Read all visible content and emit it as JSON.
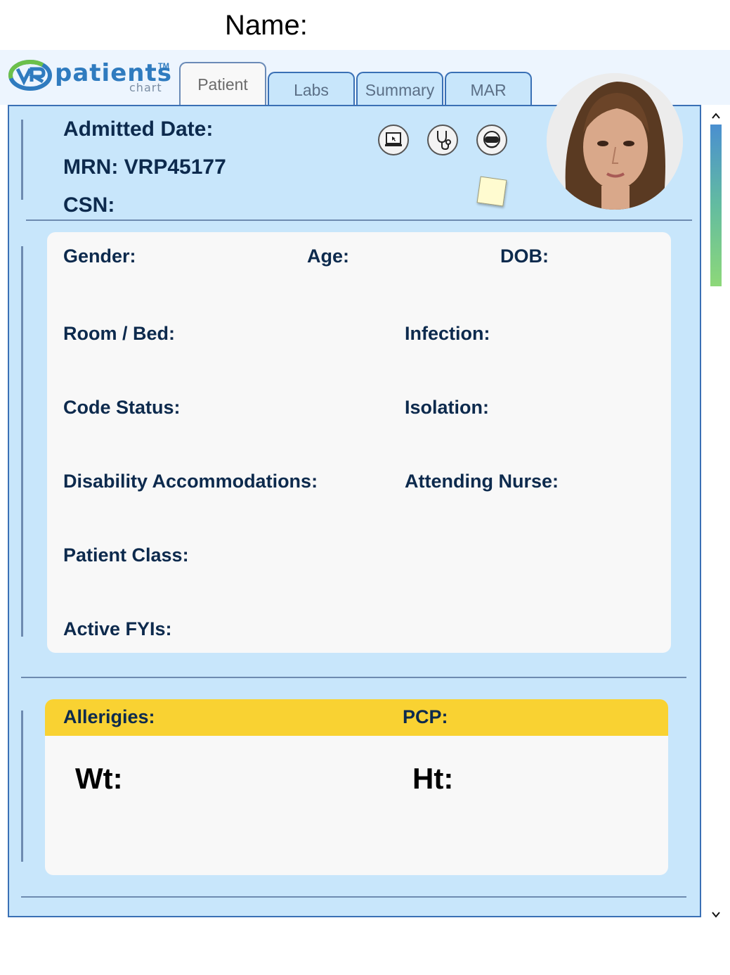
{
  "header": {
    "name_label": "Name:"
  },
  "logo": {
    "word": "patients",
    "sub": "chart",
    "tm": "TM",
    "vr": "VR"
  },
  "tabs": [
    {
      "label": "Patient",
      "active": true
    },
    {
      "label": "Labs",
      "active": false
    },
    {
      "label": "Summary",
      "active": false
    },
    {
      "label": "MAR",
      "active": false
    }
  ],
  "summary": {
    "admitted_label": "Admitted Date:",
    "mrn_label": "MRN: VRP45177",
    "csn_label": "CSN:"
  },
  "icons": [
    "monitor-icon",
    "stethoscope-icon",
    "vr-headset-icon"
  ],
  "details": {
    "gender": "Gender:",
    "age": "Age:",
    "dob": "DOB:",
    "room_bed": "Room / Bed:",
    "infection": "Infection:",
    "code_status": "Code Status:",
    "isolation": "Isolation:",
    "disability": "Disability Accommodations:",
    "attending_nurse": "Attending Nurse:",
    "patient_class": "Patient Class:",
    "active_fyis": "Active FYIs:"
  },
  "allergies": {
    "allergies_label": "Allerigies:",
    "pcp_label": "PCP:",
    "wt_label": "Wt:",
    "ht_label": "Ht:"
  },
  "scrollbar": {
    "up": "^",
    "down": "v"
  },
  "colors": {
    "panel": "#c8e6fb",
    "border": "#3a70b5",
    "text": "#0d2a4d",
    "allergy_bar": "#f9d232",
    "card": "#f8f8f8"
  }
}
